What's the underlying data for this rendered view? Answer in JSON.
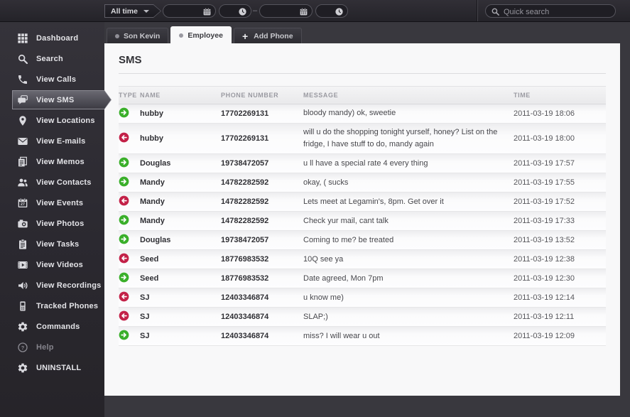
{
  "topbar": {
    "range_select": {
      "value": "All time",
      "icon": "chevron-down-icon"
    },
    "date_from": {
      "value": "",
      "icon": "calendar-icon"
    },
    "time_from": {
      "value": "",
      "icon": "clock-icon"
    },
    "range_dash": "–",
    "date_to": {
      "value": "",
      "icon": "calendar-icon"
    },
    "time_to": {
      "value": "",
      "icon": "clock-icon"
    },
    "search": {
      "placeholder": "Quick search",
      "icon": "search-icon"
    }
  },
  "sidebar": {
    "items": [
      {
        "label": "Dashboard",
        "icon": "dashboard-icon"
      },
      {
        "label": "Search",
        "icon": "search-icon"
      },
      {
        "label": "View Calls",
        "icon": "phone-handset-icon"
      },
      {
        "label": "View SMS",
        "icon": "sms-bubbles-icon",
        "active": true
      },
      {
        "label": "View Locations",
        "icon": "map-pin-icon"
      },
      {
        "label": "View E-mails",
        "icon": "envelope-icon"
      },
      {
        "label": "View Memos",
        "icon": "memo-pages-icon"
      },
      {
        "label": "View Contacts",
        "icon": "contacts-icon"
      },
      {
        "label": "View Events",
        "icon": "calendar-27-icon"
      },
      {
        "label": "View Photos",
        "icon": "camera-icon"
      },
      {
        "label": "View Tasks",
        "icon": "clipboard-icon"
      },
      {
        "label": "View Videos",
        "icon": "video-icon"
      },
      {
        "label": "View Recordings",
        "icon": "speaker-icon"
      },
      {
        "label": "Tracked Phones",
        "icon": "mobile-phone-icon"
      },
      {
        "label": "Commands",
        "icon": "gear-icon"
      },
      {
        "label": "Help",
        "icon": "help-icon",
        "muted": true
      },
      {
        "label": "UNINSTALL",
        "icon": "gear-icon"
      }
    ]
  },
  "tabs": [
    {
      "label": "Son Kevin",
      "kind": "phone"
    },
    {
      "label": "Employee",
      "kind": "phone",
      "active": true
    },
    {
      "label": "Add Phone",
      "kind": "add"
    }
  ],
  "page": {
    "title": "SMS"
  },
  "table": {
    "columns": [
      "TYPE",
      "NAME",
      "PHONE NUMBER",
      "MESSAGE",
      "TIME"
    ],
    "rows": [
      {
        "direction": "incoming",
        "name": "hubby",
        "phone": "17702269131",
        "message": "bloody mandy) ok, sweetie",
        "time": "2011-03-19 18:06"
      },
      {
        "direction": "outgoing",
        "name": "hubby",
        "phone": "17702269131",
        "message": "will u do the shopping tonight yurself, honey? List on the fridge, I have stuff to do, mandy again",
        "time": "2011-03-19 18:00"
      },
      {
        "direction": "incoming",
        "name": "Douglas",
        "phone": "19738472057",
        "message": "u ll have a special rate 4 every thing",
        "time": "2011-03-19 17:57"
      },
      {
        "direction": "incoming",
        "name": "Mandy",
        "phone": "14782282592",
        "message": "okay, ( sucks",
        "time": "2011-03-19 17:55"
      },
      {
        "direction": "outgoing",
        "name": "Mandy",
        "phone": "14782282592",
        "message": "Lets meet at Legamin's, 8pm. Get over it",
        "time": "2011-03-19 17:52"
      },
      {
        "direction": "incoming",
        "name": "Mandy",
        "phone": "14782282592",
        "message": "Check yur mail, cant talk",
        "time": "2011-03-19 17:33"
      },
      {
        "direction": "incoming",
        "name": "Douglas",
        "phone": "19738472057",
        "message": "Coming to me? be treated",
        "time": "2011-03-19 13:52"
      },
      {
        "direction": "outgoing",
        "name": "Seed",
        "phone": "18776983532",
        "message": "10Q see ya",
        "time": "2011-03-19 12:38"
      },
      {
        "direction": "incoming",
        "name": "Seed",
        "phone": "18776983532",
        "message": "Date agreed, Mon 7pm",
        "time": "2011-03-19 12:30"
      },
      {
        "direction": "outgoing",
        "name": "SJ",
        "phone": "12403346874",
        "message": "u know me)",
        "time": "2011-03-19 12:14"
      },
      {
        "direction": "outgoing",
        "name": "SJ",
        "phone": "12403346874",
        "message": "SLAP;)",
        "time": "2011-03-19 12:11"
      },
      {
        "direction": "incoming",
        "name": "SJ",
        "phone": "12403346874",
        "message": "miss? I will wear u out",
        "time": "2011-03-19 12:09"
      }
    ]
  },
  "colors": {
    "incoming_green": "#3aaf2a",
    "outgoing_red": "#c32148"
  }
}
